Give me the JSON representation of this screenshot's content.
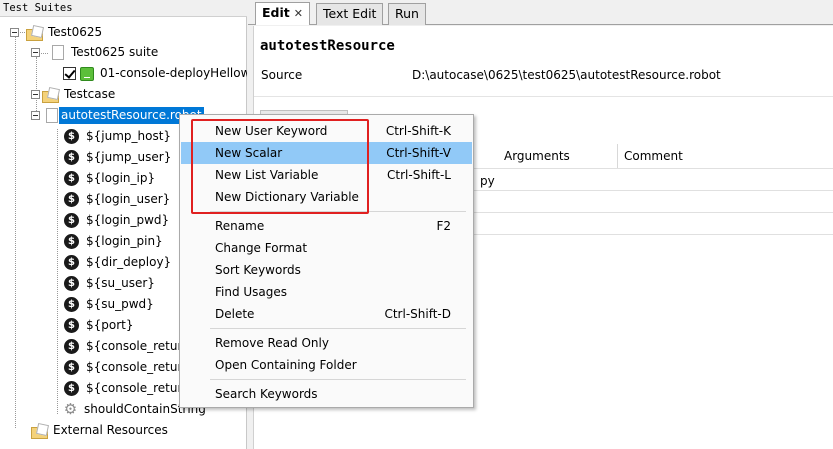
{
  "left_panel": {
    "header": "Test Suites",
    "tree": {
      "root": "Test0625",
      "suite": "Test0625 suite",
      "testcase_item": "01-console-deployHellow",
      "testcase_folder": "Testcase",
      "resource": "autotestResource.robot",
      "variables": [
        "${jump_host}",
        "${jump_user}",
        "${login_ip}",
        "${login_user}",
        "${login_pwd}",
        "${login_pin}",
        "${dir_deploy}",
        "${su_user}",
        "${su_pwd}",
        "${port}",
        "${console_return",
        "${console_return",
        "${console_return"
      ],
      "keyword": "shouldContainString",
      "external": "External Resources"
    }
  },
  "tabs": [
    {
      "label": "Edit",
      "close": "✕"
    },
    {
      "label": "Text Edit"
    },
    {
      "label": "Run"
    }
  ],
  "editor": {
    "title": "autotestResource",
    "source_label": "Source",
    "source_value": "D:\\autocase\\0625\\test0625\\autotestResource.robot",
    "columns": [
      "Arguments",
      "Comment"
    ],
    "cell_fragment": "py"
  },
  "context_menu": {
    "items": [
      {
        "label": "New User Keyword",
        "shortcut": "Ctrl-Shift-K"
      },
      {
        "label": "New Scalar",
        "shortcut": "Ctrl-Shift-V"
      },
      {
        "label": "New List Variable",
        "shortcut": "Ctrl-Shift-L"
      },
      {
        "label": "New Dictionary Variable",
        "shortcut": ""
      },
      {
        "label": "Rename",
        "shortcut": "F2"
      },
      {
        "label": "Change Format",
        "shortcut": ""
      },
      {
        "label": "Sort Keywords",
        "shortcut": ""
      },
      {
        "label": "Find Usages",
        "shortcut": ""
      },
      {
        "label": "Delete",
        "shortcut": "Ctrl-Shift-D"
      },
      {
        "label": "Remove Read Only",
        "shortcut": ""
      },
      {
        "label": "Open Containing Folder",
        "shortcut": ""
      },
      {
        "label": "Search Keywords",
        "shortcut": ""
      }
    ],
    "highlighted": "New Scalar"
  },
  "colors": {
    "selection": "#0078d7",
    "menu_highlight": "#91c9f7",
    "annotation_box": "#e02020"
  }
}
